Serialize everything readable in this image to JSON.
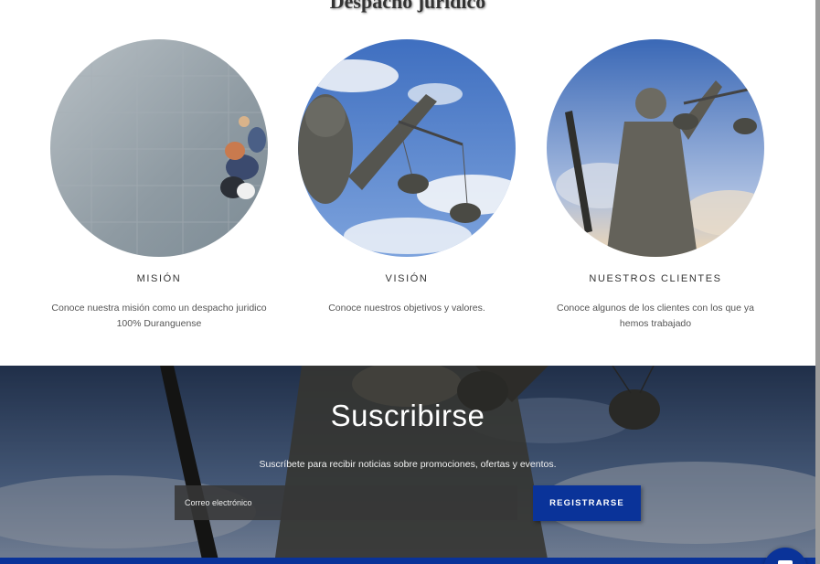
{
  "page": {
    "section_title": "Despacho jurídico"
  },
  "cards": [
    {
      "title": "MISIÓN",
      "text": "Conoce nuestra misión como un despacho juridico 100% Duranguense",
      "image": "people-on-stone-floor"
    },
    {
      "title": "VISIÓN",
      "text": "Conoce nuestros objetivos y valores.",
      "image": "justice-scales-sky"
    },
    {
      "title": "NUESTROS CLIENTES",
      "text": "Conoce algunos de los clientes con los que ya hemos trabajado",
      "image": "lady-justice-statue"
    }
  ],
  "subscribe": {
    "title": "Suscribirse",
    "text": "Suscríbete para recibir noticias sobre promociones, ofertas y eventos.",
    "email_placeholder": "Correo electrónico",
    "button_label": "REGISTRARSE"
  },
  "colors": {
    "accent": "#0a3399",
    "text_dark": "#333333",
    "text_muted": "#555555"
  }
}
